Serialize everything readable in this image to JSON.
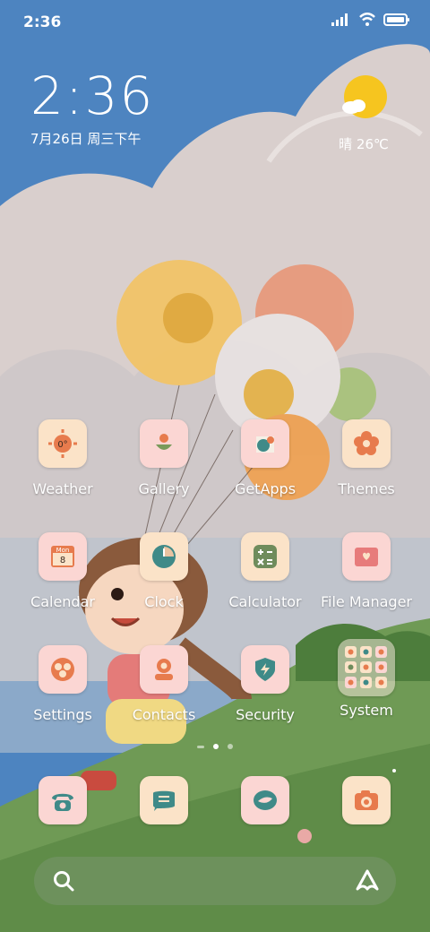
{
  "status_bar": {
    "time": "2:36"
  },
  "clock_widget": {
    "time": "2:36",
    "date": "7月26日 周三下午"
  },
  "weather_widget": {
    "text": "晴 26℃",
    "icon": "sun-cloud-icon"
  },
  "apps": [
    {
      "id": "weather",
      "label": "Weather",
      "icon": "weather-icon",
      "icon_text": "0°"
    },
    {
      "id": "gallery",
      "label": "Gallery",
      "icon": "gallery-icon"
    },
    {
      "id": "getapps",
      "label": "GetApps",
      "icon": "getapps-icon"
    },
    {
      "id": "themes",
      "label": "Themes",
      "icon": "themes-icon"
    },
    {
      "id": "calendar",
      "label": "Calendar",
      "icon": "calendar-icon",
      "icon_text_1": "Mon",
      "icon_text_2": "8"
    },
    {
      "id": "clock",
      "label": "Clock",
      "icon": "clock-icon"
    },
    {
      "id": "calculator",
      "label": "Calculator",
      "icon": "calculator-icon"
    },
    {
      "id": "filemanager",
      "label": "File Manager",
      "icon": "folder-icon"
    },
    {
      "id": "settings",
      "label": "Settings",
      "icon": "settings-icon"
    },
    {
      "id": "contacts",
      "label": "Contacts",
      "icon": "contacts-icon"
    },
    {
      "id": "security",
      "label": "Security",
      "icon": "security-icon"
    },
    {
      "id": "system",
      "label": "System",
      "icon": "system-folder-icon"
    }
  ],
  "dock": [
    {
      "id": "phone",
      "icon": "phone-icon"
    },
    {
      "id": "messages",
      "icon": "messages-icon"
    },
    {
      "id": "browser",
      "icon": "browser-icon"
    },
    {
      "id": "camera",
      "icon": "camera-icon"
    }
  ],
  "search_bar": {
    "left_icon": "search-icon",
    "right_icon": "assistant-icon"
  },
  "colors": {
    "sky": "#4d84c0",
    "cloud": "#d9cfcd",
    "hill": "#6f9a55",
    "icon_bg_peach": "#fbe3c8",
    "icon_bg_pink": "#fbd6d3",
    "accent_orange": "#e77b4d"
  }
}
